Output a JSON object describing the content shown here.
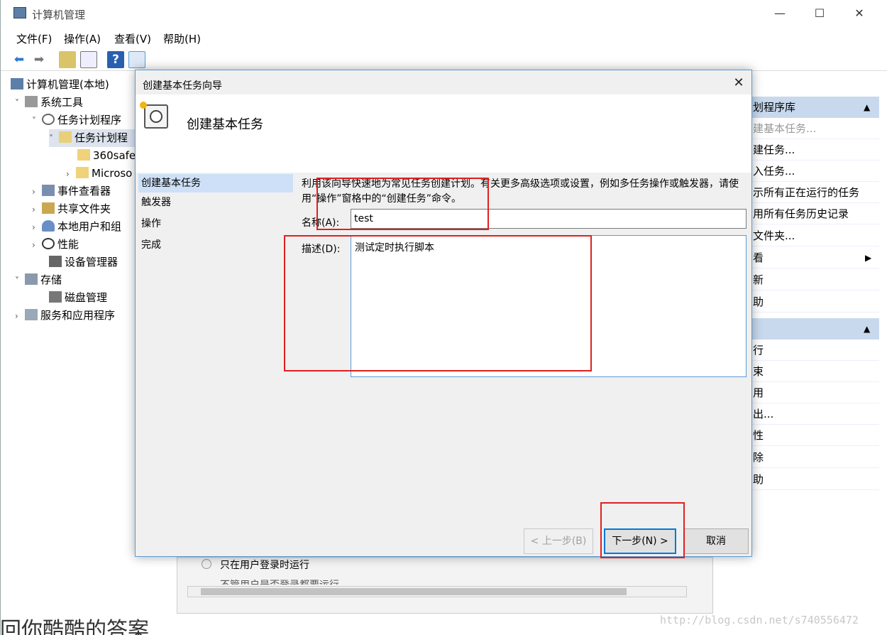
{
  "main": {
    "title": "计算机管理",
    "controls": {
      "minimize": "—",
      "maximize": "☐",
      "close": "✕"
    },
    "menu": [
      "文件(F)",
      "操作(A)",
      "查看(V)",
      "帮助(H)"
    ]
  },
  "tree": {
    "items": [
      {
        "label": "计算机管理(本地)",
        "arrow": ""
      },
      {
        "label": "系统工具",
        "arrow": "˅"
      },
      {
        "label": "任务计划程序",
        "arrow": "˅"
      },
      {
        "label": "任务计划程",
        "arrow": "˅"
      },
      {
        "label": "360safe",
        "arrow": ""
      },
      {
        "label": "Microso",
        "arrow": "›"
      },
      {
        "label": "事件查看器",
        "arrow": "›"
      },
      {
        "label": "共享文件夹",
        "arrow": "›"
      },
      {
        "label": "本地用户和组",
        "arrow": "›"
      },
      {
        "label": "性能",
        "arrow": "›"
      },
      {
        "label": "设备管理器",
        "arrow": ""
      },
      {
        "label": "存储",
        "arrow": "˅"
      },
      {
        "label": "磁盘管理",
        "arrow": ""
      },
      {
        "label": "服务和应用程序",
        "arrow": "›"
      }
    ]
  },
  "actions": {
    "section1": "划程序库",
    "items1": [
      "建基本任务...",
      "建任务...",
      "入任务...",
      "示所有正在运行的任务",
      "用所有任务历史记录",
      "文件夹...",
      "看",
      "新",
      "助"
    ],
    "items2": [
      "行",
      "束",
      "用",
      "出...",
      "性",
      "除",
      "助"
    ]
  },
  "bottom": {
    "radio1": "只在用户登录时运行",
    "radio2": "不管用户是否登录都要运行"
  },
  "dialog": {
    "title": "创建基本任务向导",
    "close": "✕",
    "heading": "创建基本任务",
    "steps": [
      "创建基本任务",
      "触发器",
      "操作",
      "完成"
    ],
    "intro": "利用该向导快速地为常见任务创建计划。有关更多高级选项或设置，例如多任务操作或触发器，请使用“操作”窗格中的“创建任务”命令。",
    "name_label": "名称(A):",
    "name_value": "test",
    "desc_label": "描述(D):",
    "desc_value": "测试定时执行脚本",
    "prev_label": "< 上一步(B)",
    "next_label": "下一步(N) >",
    "cancel_label": "取消"
  },
  "watermark": "http://blog.csdn.net/s740556472",
  "overlay_text": "回你酷酷的答案",
  "colors": {
    "accent": "#0078d7",
    "highlight": "#e02020",
    "selected": "#cde0f7"
  }
}
